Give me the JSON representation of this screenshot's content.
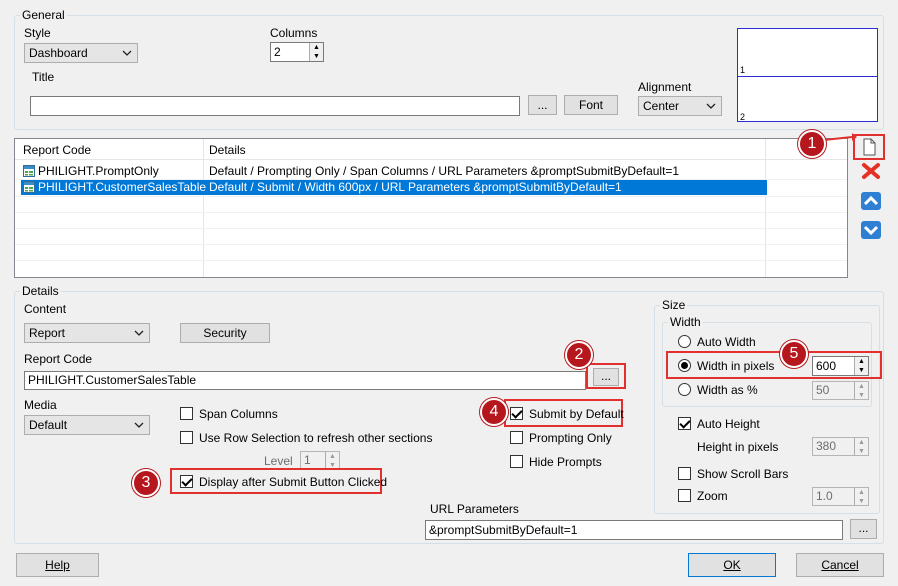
{
  "general": {
    "legend": "General",
    "style_label": "Style",
    "style_value": "Dashboard",
    "columns_label": "Columns",
    "columns_value": "2",
    "title_label": "Title",
    "title_value": "",
    "ellipsis": "...",
    "font_button": "Font",
    "alignment_label": "Alignment",
    "alignment_value": "Center",
    "preview_labels": [
      "1",
      "2"
    ]
  },
  "report_list": {
    "headers": [
      "Report Code",
      "Details"
    ],
    "rows": [
      {
        "code": "PHILIGHT.PromptOnly",
        "details": "Default / Prompting Only / Span Columns / URL Parameters &promptSubmitByDefault=1",
        "selected": false
      },
      {
        "code": "PHILIGHT.CustomerSalesTable",
        "details": "Default / Submit / Width 600px / URL Parameters &promptSubmitByDefault=1",
        "selected": true
      }
    ]
  },
  "details": {
    "legend": "Details",
    "content_label": "Content",
    "content_value": "Report",
    "security_button": "Security",
    "report_code_label": "Report Code",
    "report_code_value": "PHILIGHT.CustomerSalesTable",
    "ellipsis": "...",
    "media_label": "Media",
    "media_value": "Default",
    "span_columns": "Span Columns",
    "use_row_selection": "Use Row Selection to refresh other sections",
    "level_label": "Level",
    "level_value": "1",
    "display_after_submit": "Display after Submit Button Clicked",
    "submit_by_default": "Submit by Default",
    "prompting_only": "Prompting Only",
    "hide_prompts": "Hide Prompts",
    "url_params_label": "URL Parameters",
    "url_params_value": "&promptSubmitByDefault=1"
  },
  "size": {
    "legend": "Size",
    "width_legend": "Width",
    "auto_width": "Auto Width",
    "width_in_pixels": "Width in pixels",
    "width_pixels_value": "600",
    "width_as_pct": "Width as %",
    "width_pct_value": "50",
    "auto_height": "Auto Height",
    "height_in_pixels": "Height in pixels",
    "height_value": "380",
    "show_scroll_bars": "Show Scroll Bars",
    "zoom": "Zoom",
    "zoom_value": "1.0"
  },
  "footer": {
    "help": "Help",
    "ok": "OK",
    "cancel": "Cancel"
  },
  "callouts": [
    "1",
    "2",
    "3",
    "4",
    "5"
  ],
  "colors": {
    "accent_selection": "#0078d7",
    "callout_red": "#b5171d",
    "highlight_red": "#e0312f"
  }
}
